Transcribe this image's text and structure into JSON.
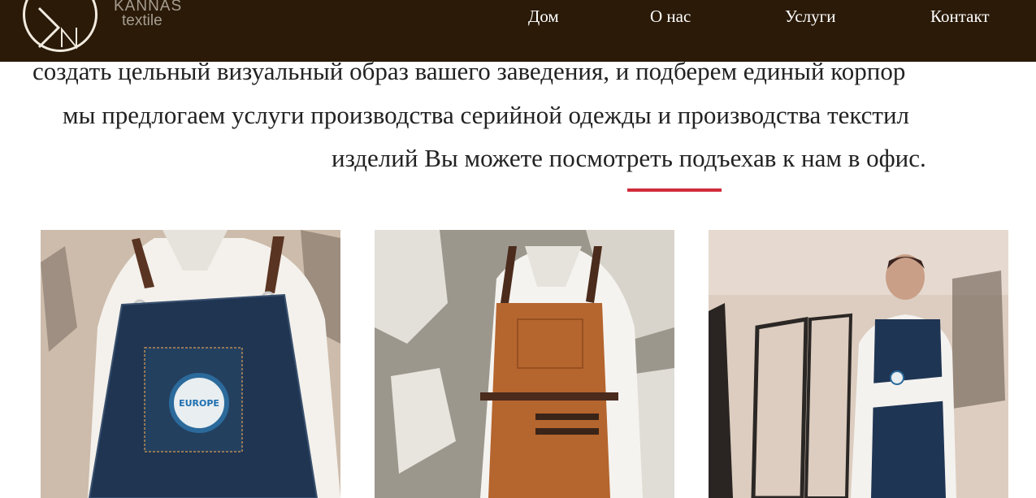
{
  "brand": {
    "name": "KANNAS",
    "sub": "textile",
    "mark": "N-monogram-logo"
  },
  "nav": {
    "items": [
      {
        "label": "Дом"
      },
      {
        "label": "О нас"
      },
      {
        "label": "Услуги"
      },
      {
        "label": "Контакт"
      }
    ]
  },
  "intro": {
    "line1": "создать цельный визуальный образ вашего заведения, и подберем единый корпор",
    "line2": "мы предлогаем услуги производства серийной одежды и производства текстил",
    "line3": "изделий Вы можете посмотреть подъехав к нам в офис."
  },
  "gallery": {
    "badge_text": "EUROPE",
    "items": [
      {
        "icon": "denim-apron-closeup-photo"
      },
      {
        "icon": "leather-apron-photo"
      },
      {
        "icon": "denim-apron-model-photo"
      }
    ]
  },
  "colors": {
    "header_bg": "#2a1a07",
    "accent_divider": "#d12b3c",
    "text": "#222222",
    "nav_text": "#ffffff"
  }
}
